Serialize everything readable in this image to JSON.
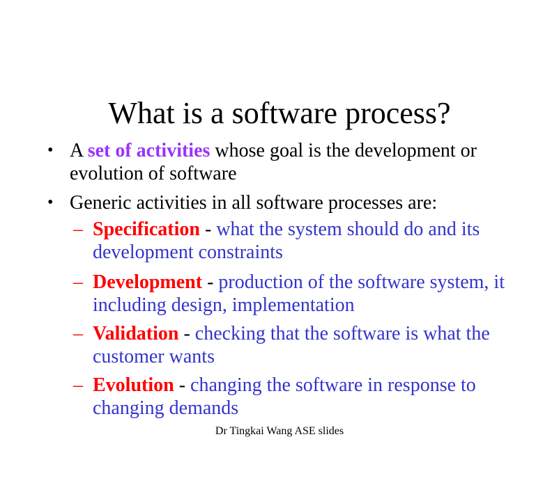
{
  "slide": {
    "title": "What is a software process?",
    "bullets": [
      {
        "prefix": "A ",
        "highlight": "set of activities",
        "suffix": " whose goal is the development or evolution of software"
      },
      {
        "text": "Generic activities in all software processes are:"
      }
    ],
    "sub_bullets": [
      {
        "dash": "–",
        "term": "Specification",
        "sep": " - ",
        "desc": "what the system should do and its development constraints"
      },
      {
        "dash": "–",
        "term": "Development",
        "sep": " - ",
        "desc": "production of the software system, it including design, implementation"
      },
      {
        "dash": "–",
        "term": "Validation",
        "sep": " - ",
        "desc": "checking that the software is what the customer wants"
      },
      {
        "dash": "–",
        "term": "Evolution",
        "sep": " - ",
        "desc": "changing the software in response to changing demands"
      }
    ],
    "footer": "Dr Tingkai Wang ASE slides",
    "colors": {
      "highlight": "#9933ff",
      "term": "#ff0000",
      "description": "#3333cc"
    }
  }
}
